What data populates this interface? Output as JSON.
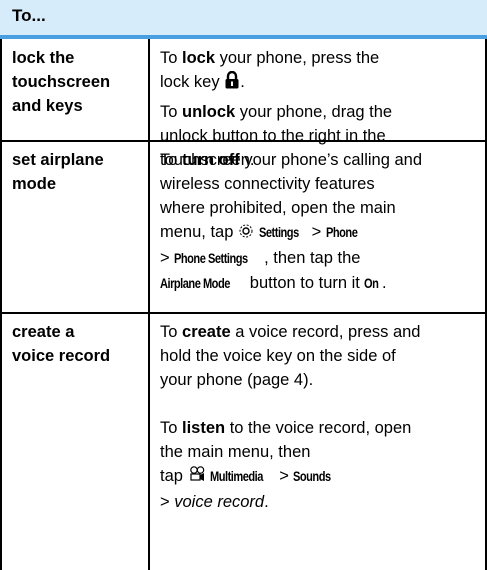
{
  "header": {
    "label": "To..."
  },
  "rows": [
    {
      "action": "lock the touchscreen and keys",
      "action_lines": [
        "lock the",
        "touchscreen",
        "and keys"
      ],
      "p1": {
        "a": "To ",
        "b": "lock",
        "c": " your phone, press the",
        "d": "lock key",
        "e": "."
      },
      "p2": {
        "a": "To ",
        "b": "unlock",
        "c": " your phone, drag the",
        "d": "unlock button to the right in the",
        "e": "touchscreen."
      }
    },
    {
      "action": "set airplane mode",
      "action_lines": [
        "set airplane",
        "mode"
      ],
      "p1": {
        "a": "To ",
        "b": "turn off",
        "c": " your phone’s calling and",
        "d": "wireless connectivity features",
        "e": "where prohibited, open the main",
        "f": "menu, tap ",
        "settings": "Settings",
        "gt1": " > ",
        "phone": "Phone",
        "gt2": "> ",
        "phone_settings": "Phone Settings",
        "then": ", then tap the",
        "airplane": "Airplane Mode",
        "button_text": " button to turn it ",
        "on": "On",
        "end": "."
      }
    },
    {
      "action": "create a voice record",
      "action_lines": [
        "create a",
        "voice record"
      ],
      "p1": {
        "a": "To ",
        "b": "create",
        "c": " a voice record, press and",
        "d": "hold the voice key on the side of",
        "e": "your phone (page 4)."
      },
      "p2": {
        "a": "To ",
        "b": "listen",
        "c": " to the voice record, open",
        "d": "the main menu, then",
        "e": "tap ",
        "multimedia": "Multimedia",
        "gt1": " > ",
        "sounds": "Sounds",
        "gt2": "> ",
        "voice": "voice record",
        "end": "."
      }
    }
  ],
  "icons": {
    "lock": "lock-icon",
    "settings": "gear-icon",
    "multimedia": "multimedia-icon"
  },
  "colors": {
    "header_bg": "#d7ecfa",
    "header_rule": "#4a9fe0"
  }
}
